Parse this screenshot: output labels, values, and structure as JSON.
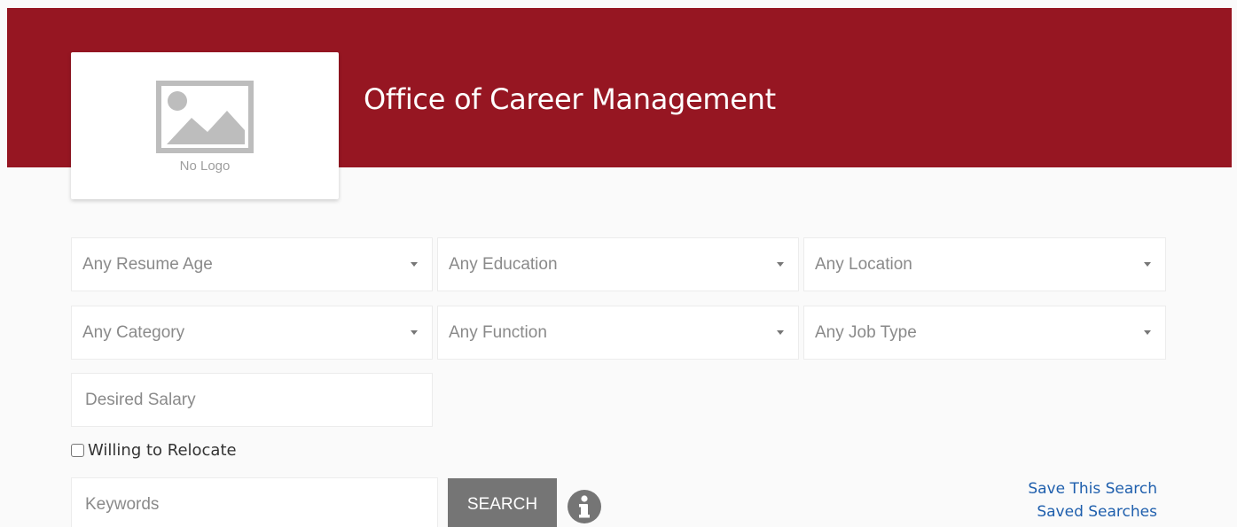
{
  "header": {
    "title": "Office of Career Management",
    "logo_placeholder_text": "No Logo",
    "brand_color": "#961622"
  },
  "filters": {
    "resume_age": "Any Resume Age",
    "education": "Any Education",
    "location": "Any Location",
    "category": "Any Category",
    "function": "Any Function",
    "job_type": "Any Job Type",
    "desired_salary_placeholder": "Desired Salary"
  },
  "relocate": {
    "label": "Willing to Relocate",
    "checked": false
  },
  "search": {
    "keywords_placeholder": "Keywords",
    "button_label": "SEARCH",
    "info_icon": "info-icon"
  },
  "links": {
    "save_search": "Save This Search",
    "saved_searches": "Saved Searches",
    "link_color": "#1f5fad"
  }
}
